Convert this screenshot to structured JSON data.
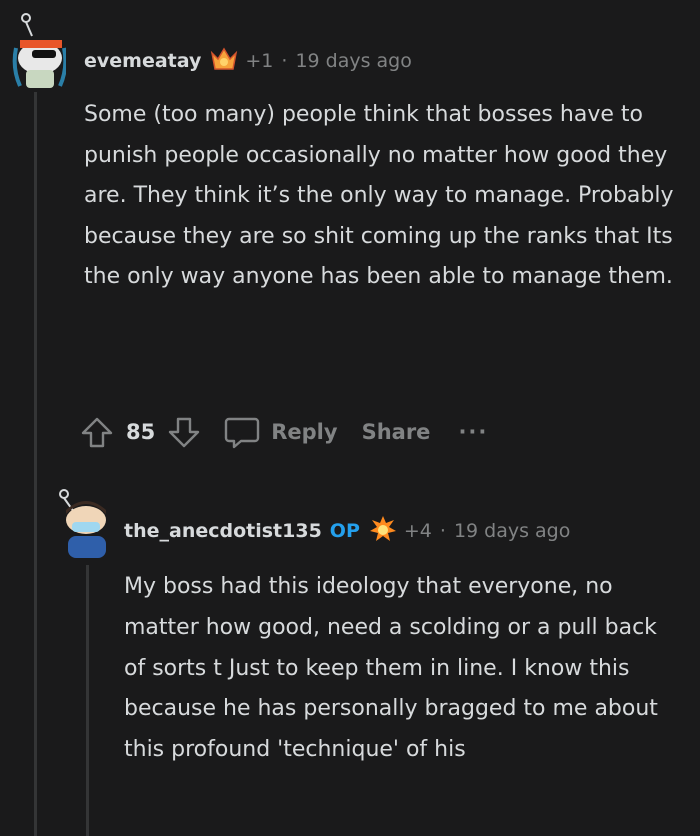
{
  "comments": [
    {
      "username": "evemeatay",
      "award_icon": "crown-award-icon",
      "award_count": "+1",
      "separator": "·",
      "time_ago": "19 days ago",
      "body": "Some (too many) people think that bosses have to punish people occasionally no matter how good they are. They think it’s the only way to manage. Probably because they are so shit coming up the ranks that Its the only way anyone has been able to manage them.",
      "score": "85",
      "reply_label": "Reply",
      "share_label": "Share",
      "more_label": "···"
    },
    {
      "username": "the_anecdotist135",
      "op_badge": "OP",
      "award_icon": "fire-burst-award-icon",
      "award_count": "+4",
      "separator": "·",
      "time_ago": "19 days ago",
      "body": "My boss had this ideology that everyone, no matter how good, need a scolding or a pull back of sorts t Just to keep them in line. I know this because he has personally bragged to me about this profound 'technique' of his"
    }
  ],
  "colors": {
    "background": "#1a1a1b",
    "text": "#d7dadc",
    "muted": "#818384",
    "op": "#24a0ed",
    "thread_line": "#343536"
  }
}
